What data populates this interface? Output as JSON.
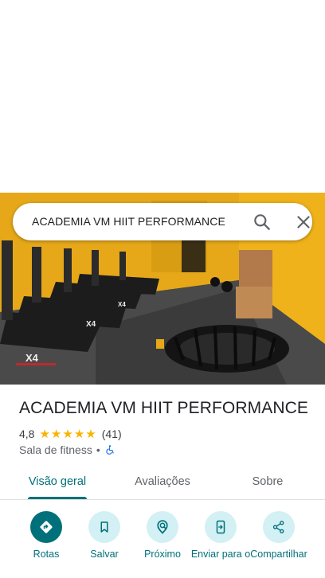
{
  "search": {
    "query": "ACADEMIA VM HIIT PERFORMANCE",
    "search_icon": "search-icon",
    "close_icon": "close-icon"
  },
  "place": {
    "name": "ACADEMIA VM HIIT PERFORMANCE",
    "rating": "4,8",
    "stars": 5,
    "reviews": "(41)",
    "category": "Sala de fitness",
    "separator": "•",
    "accessibility_icon": "wheelchair-icon"
  },
  "tabs": [
    {
      "label": "Visão geral",
      "active": true
    },
    {
      "label": "Avaliações",
      "active": false
    },
    {
      "label": "Sobre",
      "active": false
    }
  ],
  "actions": [
    {
      "label": "Rotas",
      "icon": "directions-icon"
    },
    {
      "label": "Salvar",
      "icon": "bookmark-icon"
    },
    {
      "label": "Próximo",
      "icon": "nearby-icon"
    },
    {
      "label": "Enviar para o",
      "icon": "send-to-phone-icon"
    },
    {
      "label": "Compartilhar",
      "icon": "share-icon"
    }
  ],
  "colors": {
    "accent": "#00707a",
    "accent_light": "#d3f0f4",
    "star": "#f8b400",
    "wall_yellow": "#e6a819"
  }
}
